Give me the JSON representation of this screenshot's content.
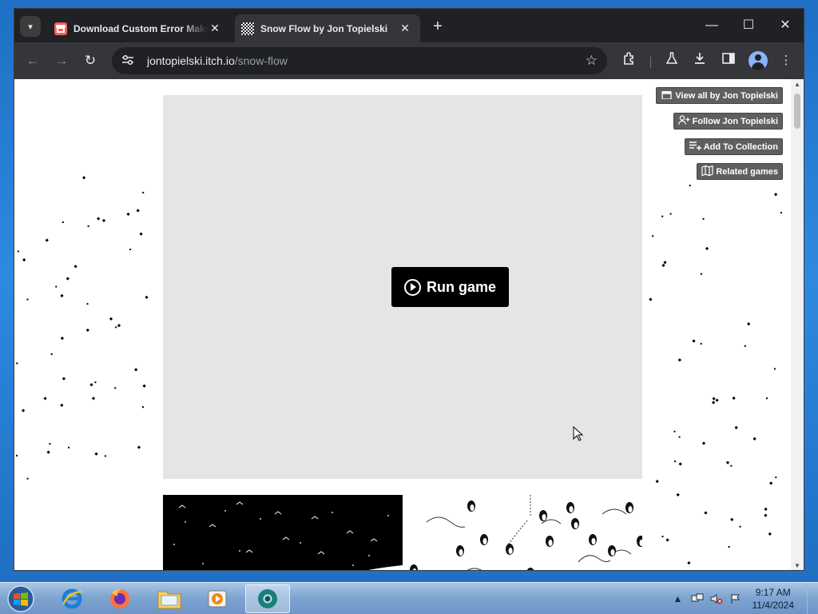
{
  "browser": {
    "tabs": [
      {
        "title": "Download Custom Error Maker",
        "favicon": "itch-icon",
        "active": false
      },
      {
        "title": "Snow Flow by Jon Topielski",
        "favicon": "snow-flow-icon",
        "active": true
      }
    ],
    "tab_close_glyph": "✕",
    "new_tab_glyph": "+",
    "address": {
      "host": "jontopielski.itch.io",
      "path": "/snow-flow"
    },
    "window_controls": {
      "minimize": "—",
      "maximize": "☐",
      "close": "✕"
    }
  },
  "page": {
    "run_game_label": "Run game",
    "user_tools": [
      {
        "label": "View all by Jon Topielski",
        "icon": "store-icon"
      },
      {
        "label": "Follow Jon Topielski",
        "icon": "follow-user-icon"
      },
      {
        "label": "Add To Collection",
        "icon": "collection-add-icon"
      },
      {
        "label": "Related games",
        "icon": "map-icon"
      }
    ],
    "frame_background": "#e5e5e5",
    "button_background": "#000000"
  },
  "taskbar": {
    "apps": [
      "internet-explorer",
      "firefox",
      "file-explorer",
      "media-player",
      "chrome"
    ],
    "active_app": "chrome",
    "clock": {
      "time": "9:17 AM",
      "date": "11/4/2024"
    }
  }
}
